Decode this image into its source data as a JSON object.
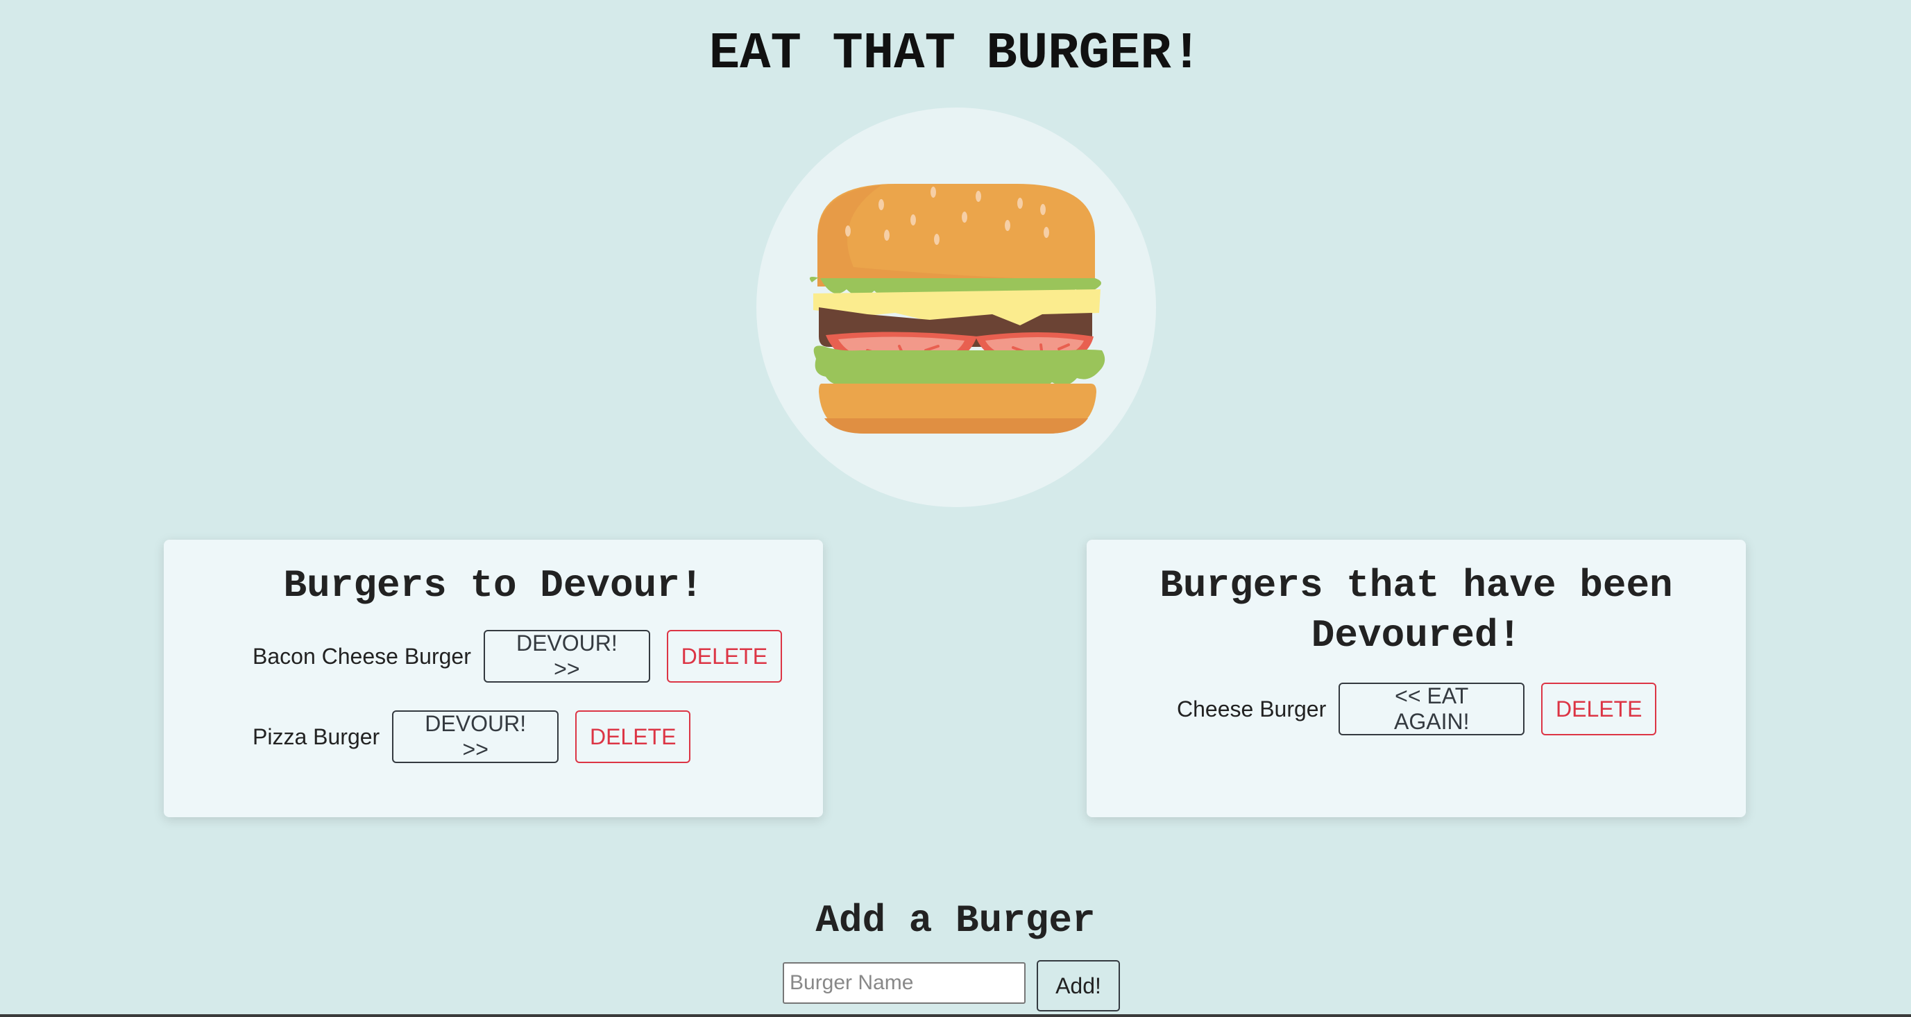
{
  "header": {
    "title": "EAT THAT BURGER!"
  },
  "hero": {
    "image_icon": "burger-illustration-icon"
  },
  "to_devour": {
    "title": "Burgers to Devour!",
    "items": [
      {
        "name": "Bacon Cheese Burger",
        "action_label": "DEVOUR! >>",
        "delete_label": "DELETE"
      },
      {
        "name": "Pizza Burger",
        "action_label": "DEVOUR! >>",
        "delete_label": "DELETE"
      }
    ]
  },
  "devoured": {
    "title": "Burgers that have been Devoured!",
    "items": [
      {
        "name": "Cheese Burger",
        "action_label": "<< EAT AGAIN!",
        "delete_label": "DELETE"
      }
    ]
  },
  "add_form": {
    "title": "Add a Burger",
    "input_value": "",
    "input_placeholder": "Burger Name",
    "submit_label": "Add!"
  },
  "colors": {
    "background": "#d5eaea",
    "card": "#eef7f9",
    "hero_circle": "#e8f3f4",
    "danger": "#dc3545",
    "dark": "#343a40"
  }
}
